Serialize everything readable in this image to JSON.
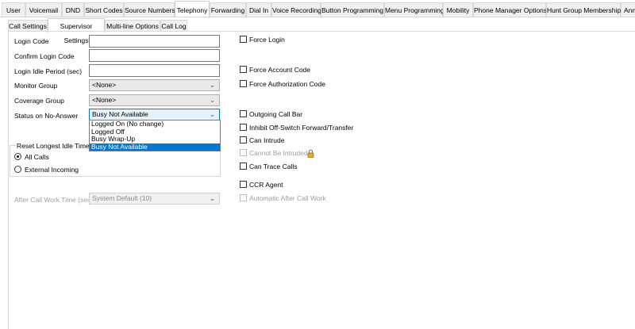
{
  "top_tabs": [
    "User",
    "Voicemail",
    "DND",
    "Short Codes",
    "Source Numbers",
    "Telephony",
    "Forwarding",
    "Dial In",
    "Voice Recording",
    "Button Programming",
    "Menu Programming",
    "Mobility",
    "Phone Manager Options",
    "Hunt Group Membership",
    "Ann"
  ],
  "active_top_tab": "Telephony",
  "sub_tabs": [
    "Call Settings",
    "Supervisor Settings",
    "Multi-line Options",
    "Call Log"
  ],
  "active_sub_tab": "Supervisor Settings",
  "form": {
    "login_code_label": "Login Code",
    "login_code_value": "",
    "confirm_login_code_label": "Confirm Login Code",
    "confirm_login_code_value": "",
    "login_idle_period_label": "Login Idle Period (sec)",
    "login_idle_period_value": "",
    "monitor_group_label": "Monitor Group",
    "monitor_group_value": "<None>",
    "coverage_group_label": "Coverage Group",
    "coverage_group_value": "<None>",
    "status_no_answer_label": "Status on No-Answer",
    "status_no_answer_value": "Busy Not Available",
    "status_no_answer_options": [
      "Logged On (No change)",
      "Logged Off",
      "Busy Wrap-Up",
      "Busy Not Available"
    ],
    "status_no_answer_selected_index": 3,
    "reset_idle_group_label": "Reset Longest Idle Time",
    "radio_all_calls": "All Calls",
    "radio_external_incoming": "External Incoming",
    "radio_selected": "All Calls",
    "after_call_work_label": "After Call Work Time (sec)",
    "after_call_work_value": "System Default (10)"
  },
  "checkboxes": {
    "force_login": "Force Login",
    "force_account_code": "Force Account Code",
    "force_authorization_code": "Force Authorization Code",
    "outgoing_call_bar": "Outgoing Call Bar",
    "inhibit_off_switch": "Inhibit Off-Switch Forward/Transfer",
    "can_intrude": "Can Intrude",
    "cannot_be_intruded": "Cannot Be Intruded",
    "can_trace_calls": "Can Trace Calls",
    "ccr_agent": "CCR Agent",
    "automatic_after_call_work": "Automatic After Call Work"
  },
  "colors": {
    "selection": "#0078d7",
    "lock_icon": "#d9a520"
  },
  "icons": {
    "dropdown": "chevron-down-icon",
    "lock": "lock-icon"
  }
}
